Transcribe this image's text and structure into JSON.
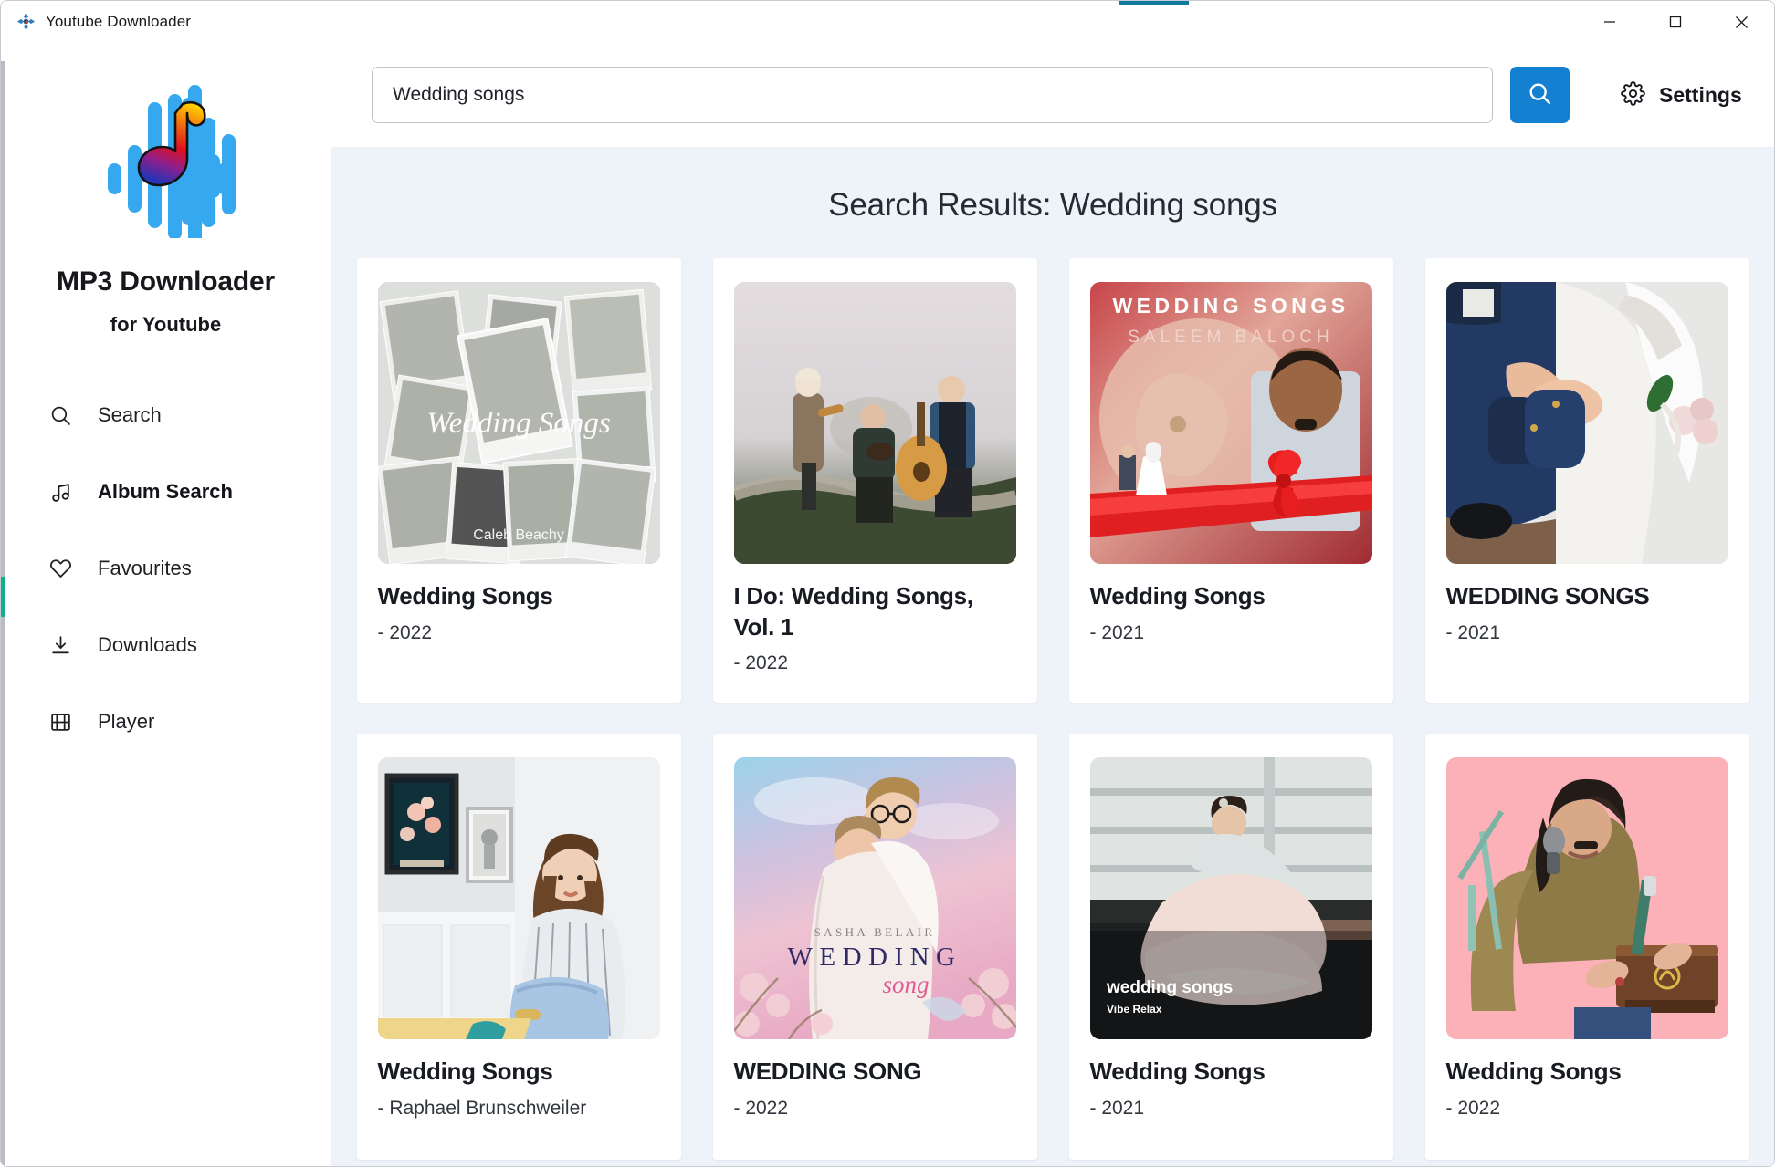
{
  "window": {
    "title": "Youtube Downloader",
    "app_icon": "app-logo-icon",
    "controls": {
      "minimize": "minimize-button",
      "maximize": "maximize-button",
      "close": "close-button"
    }
  },
  "sidebar": {
    "logo_icon": "waveform-music-note-logo",
    "brand_title": "MP3 Downloader",
    "brand_subtitle": "for Youtube",
    "items": [
      {
        "label": "Search",
        "icon": "search-icon",
        "active": false
      },
      {
        "label": "Album Search",
        "icon": "music-note-icon",
        "active": true
      },
      {
        "label": "Favourites",
        "icon": "heart-icon",
        "active": false
      },
      {
        "label": "Downloads",
        "icon": "download-icon",
        "active": false
      },
      {
        "label": "Player",
        "icon": "film-icon",
        "active": false
      }
    ]
  },
  "topbar": {
    "search_value": "Wedding songs",
    "search_placeholder": "Search",
    "search_button_icon": "search-icon",
    "settings_label": "Settings",
    "settings_icon": "gear-icon"
  },
  "main": {
    "results_title": "Search Results: Wedding songs",
    "results": [
      {
        "title": "Wedding Songs",
        "year": "- 2022",
        "art": {
          "style": "polaroid-collage",
          "script_text": "Wedding Songs",
          "credit_text": "Caleb Beachy"
        }
      },
      {
        "title": "I Do: Wedding Songs, Vol. 1",
        "year": "- 2022",
        "art": {
          "style": "foggy-band-photo"
        }
      },
      {
        "title": "Wedding Songs",
        "year": "- 2021",
        "art": {
          "style": "red-ribbon-portrait",
          "heading": "WEDDING SONGS",
          "subheading": "SALEEM BALOCH"
        }
      },
      {
        "title": "WEDDING SONGS",
        "year": "- 2021",
        "art": {
          "style": "hands-bride-groom"
        }
      },
      {
        "title": "Wedding Songs",
        "year": "- Raphael Brunschweiler",
        "art": {
          "style": "woman-interior-frames"
        }
      },
      {
        "title": "WEDDING SONG",
        "year": "- 2022",
        "art": {
          "style": "pastel-couple-blanket",
          "artist": "SASHA BELAIR",
          "heading": "WEDDING",
          "script": "song"
        }
      },
      {
        "title": "Wedding Songs",
        "year": "- 2021",
        "art": {
          "style": "twirling-bride",
          "overlay_title": "wedding songs",
          "overlay_sub": "Vibe Relax"
        }
      },
      {
        "title": "Wedding Songs",
        "year": "- 2022",
        "art": {
          "style": "pink-harmonium-singer"
        }
      }
    ]
  },
  "colors": {
    "accent_blue": "#1380d2",
    "content_bg": "#eef2f9",
    "titlebar_accent": "#0f7a9e",
    "scroll_thumb": "#11b08c"
  }
}
